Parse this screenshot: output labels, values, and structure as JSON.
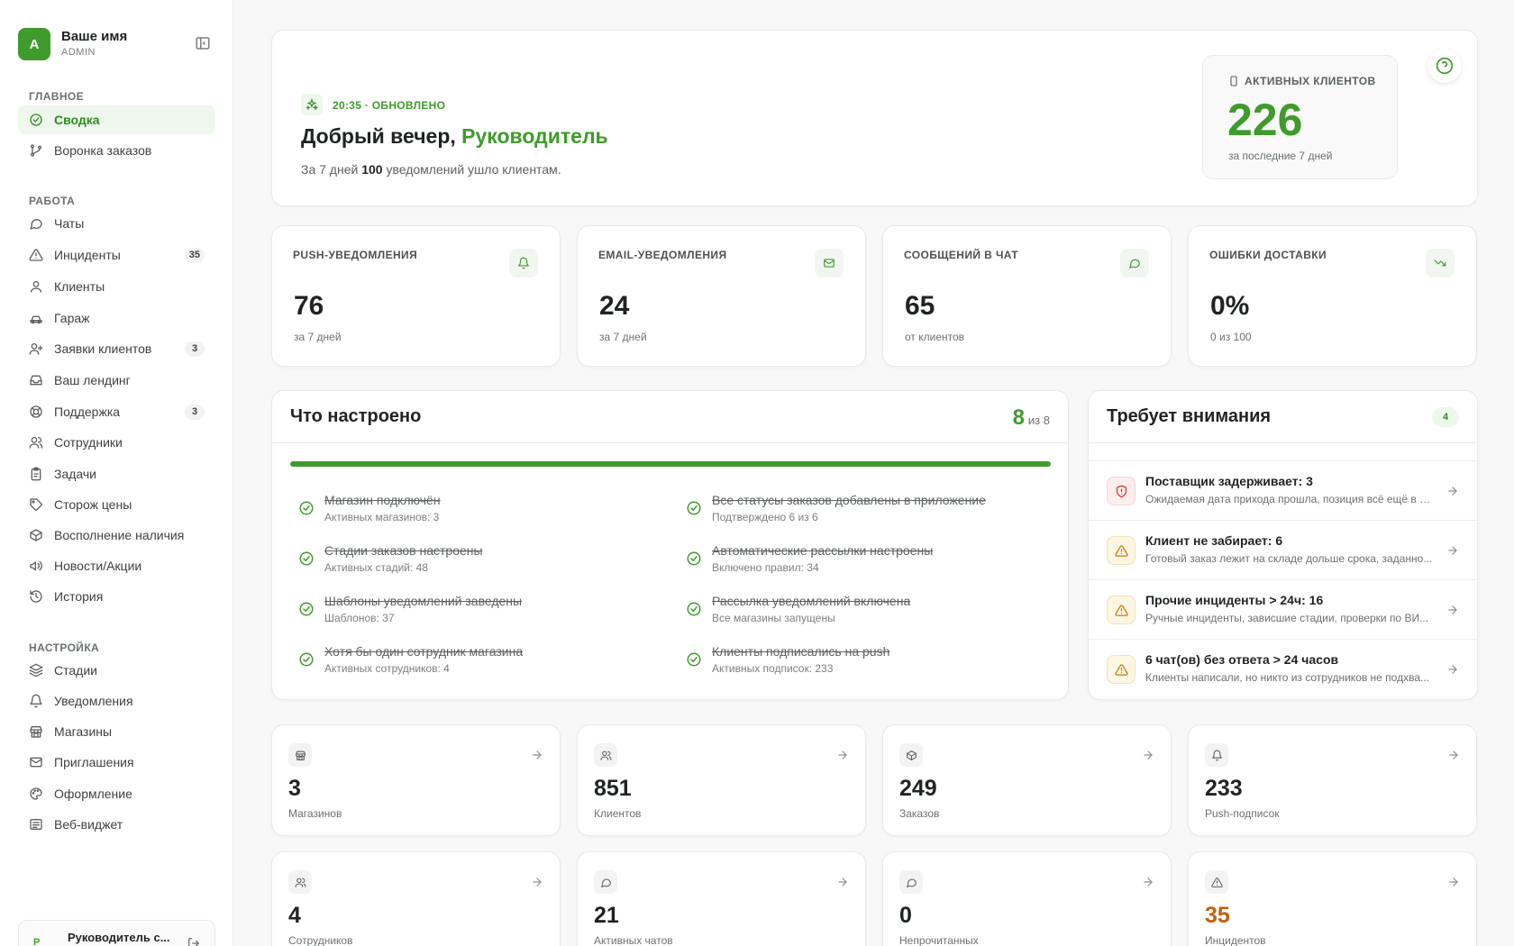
{
  "profile": {
    "initial": "A",
    "name": "Ваше имя",
    "role": "ADMIN"
  },
  "nav": {
    "sections": [
      {
        "title": "ГЛАВНОЕ",
        "items": [
          {
            "label": "Сводка",
            "icon": "dashboard-icon",
            "active": true
          },
          {
            "label": "Воронка заказов",
            "icon": "git-branch-icon"
          }
        ]
      },
      {
        "title": "РАБОТА",
        "items": [
          {
            "label": "Чаты",
            "icon": "chat-icon"
          },
          {
            "label": "Инциденты",
            "icon": "warning-icon",
            "badge": "35"
          },
          {
            "label": "Клиенты",
            "icon": "user-icon"
          },
          {
            "label": "Гараж",
            "icon": "car-icon"
          },
          {
            "label": "Заявки клиентов",
            "icon": "user-plus-icon",
            "badge": "3"
          },
          {
            "label": "Ваш лендинг",
            "icon": "inbox-icon"
          },
          {
            "label": "Поддержка",
            "icon": "lifebuoy-icon",
            "badge": "3"
          },
          {
            "label": "Сотрудники",
            "icon": "users-icon"
          },
          {
            "label": "Задачи",
            "icon": "clipboard-icon"
          },
          {
            "label": "Сторож цены",
            "icon": "tag-icon"
          },
          {
            "label": "Восполнение наличия",
            "icon": "box-icon"
          },
          {
            "label": "Новости/Акции",
            "icon": "megaphone-icon"
          },
          {
            "label": "История",
            "icon": "history-icon"
          }
        ]
      },
      {
        "title": "НАСТРОЙКА",
        "items": [
          {
            "label": "Стадии",
            "icon": "layers-icon"
          },
          {
            "label": "Уведомления",
            "icon": "bell-icon"
          },
          {
            "label": "Магазины",
            "icon": "store-icon"
          },
          {
            "label": "Приглашения",
            "icon": "mail-icon"
          },
          {
            "label": "Оформление",
            "icon": "palette-icon"
          },
          {
            "label": "Веб-виджет",
            "icon": "widget-icon"
          }
        ]
      }
    ]
  },
  "user_card": {
    "initial": "Р",
    "name": "Руководитель с..."
  },
  "hero": {
    "time": "20:35 · ОБНОВЛЕНО",
    "greeting": "Добрый вечер,",
    "name": "Руководитель",
    "sub_prefix": "За 7 дней",
    "sub_count": "100",
    "sub_suffix": "уведомлений ушло клиентам.",
    "kpi_label": "АКТИВНЫХ КЛИЕНТОВ",
    "kpi_value": "226",
    "kpi_caption": "за последние 7 дней"
  },
  "stats": [
    {
      "label": "PUSH-УВЕДОМЛЕНИЯ",
      "value": "76",
      "caption": "за 7 дней",
      "icon": "bell-icon"
    },
    {
      "label": "EMAIL-УВЕДОМЛЕНИЯ",
      "value": "24",
      "caption": "за 7 дней",
      "icon": "mail-icon"
    },
    {
      "label": "СООБЩЕНИЙ В ЧАТ",
      "value": "65",
      "caption": "от клиентов",
      "icon": "chat-icon"
    },
    {
      "label": "ОШИБКИ ДОСТАВКИ",
      "value": "0%",
      "caption": "0 из 100",
      "icon": "trending-down-icon"
    }
  ],
  "setup": {
    "title": "Что настроено",
    "done": "8",
    "total_label": "из 8",
    "progress_fraction": 1.0,
    "tasks": [
      {
        "title": "Магазин подключён",
        "sub": "Активных магазинов: 3"
      },
      {
        "title": "Все статусы заказов добавлены в приложение",
        "sub": "Подтверждено 6 из 6"
      },
      {
        "title": "Стадии заказов настроены",
        "sub": "Активных стадий: 48"
      },
      {
        "title": "Автоматические рассылки настроены",
        "sub": "Включено правил: 34"
      },
      {
        "title": "Шаблоны уведомлений заведены",
        "sub": "Шаблонов: 37"
      },
      {
        "title": "Рассылка уведомлений включена",
        "sub": "Все магазины запущены"
      },
      {
        "title": "Хотя бы один сотрудник магазина",
        "sub": "Активных сотрудников: 4"
      },
      {
        "title": "Клиенты подписались на push",
        "sub": "Активных подписок: 233"
      }
    ]
  },
  "attention": {
    "title": "Требует внимания",
    "count": "4",
    "items": [
      {
        "title": "Поставщик задерживает: 3",
        "sub": "Ожидаемая дата прихода прошла, позиция всё ещё в р...",
        "severity": "red",
        "icon": "shield-alert-icon"
      },
      {
        "title": "Клиент не забирает: 6",
        "sub": "Готовый заказ лежит на складе дольше срока, заданно...",
        "severity": "yellow",
        "icon": "warning-icon"
      },
      {
        "title": "Прочие инциденты > 24ч: 16",
        "sub": "Ручные инциденты, зависшие стадии, проверки по ВИ...",
        "severity": "yellow",
        "icon": "warning-icon"
      },
      {
        "title": "6 чат(ов) без ответа > 24 часов",
        "sub": "Клиенты написали, но никто из сотрудников не подхва...",
        "severity": "yellow",
        "icon": "warning-icon"
      }
    ]
  },
  "tiles": [
    {
      "value": "3",
      "caption": "Магазинов",
      "icon": "store-icon"
    },
    {
      "value": "851",
      "caption": "Клиентов",
      "icon": "users-icon"
    },
    {
      "value": "249",
      "caption": "Заказов",
      "icon": "box-icon"
    },
    {
      "value": "233",
      "caption": "Push-подписок",
      "icon": "bell-icon"
    },
    {
      "value": "4",
      "caption": "Сотрудников",
      "icon": "users-icon"
    },
    {
      "value": "21",
      "caption": "Активных чатов",
      "icon": "chat-icon"
    },
    {
      "value": "0",
      "caption": "Непрочитанных",
      "icon": "chat-icon"
    },
    {
      "value": "35",
      "caption": "Инцидентов",
      "icon": "warning-icon",
      "warn": true
    }
  ],
  "colors": {
    "accent": "#3f9b2c",
    "warn": "#c2600e",
    "danger": "#d43a3a"
  }
}
